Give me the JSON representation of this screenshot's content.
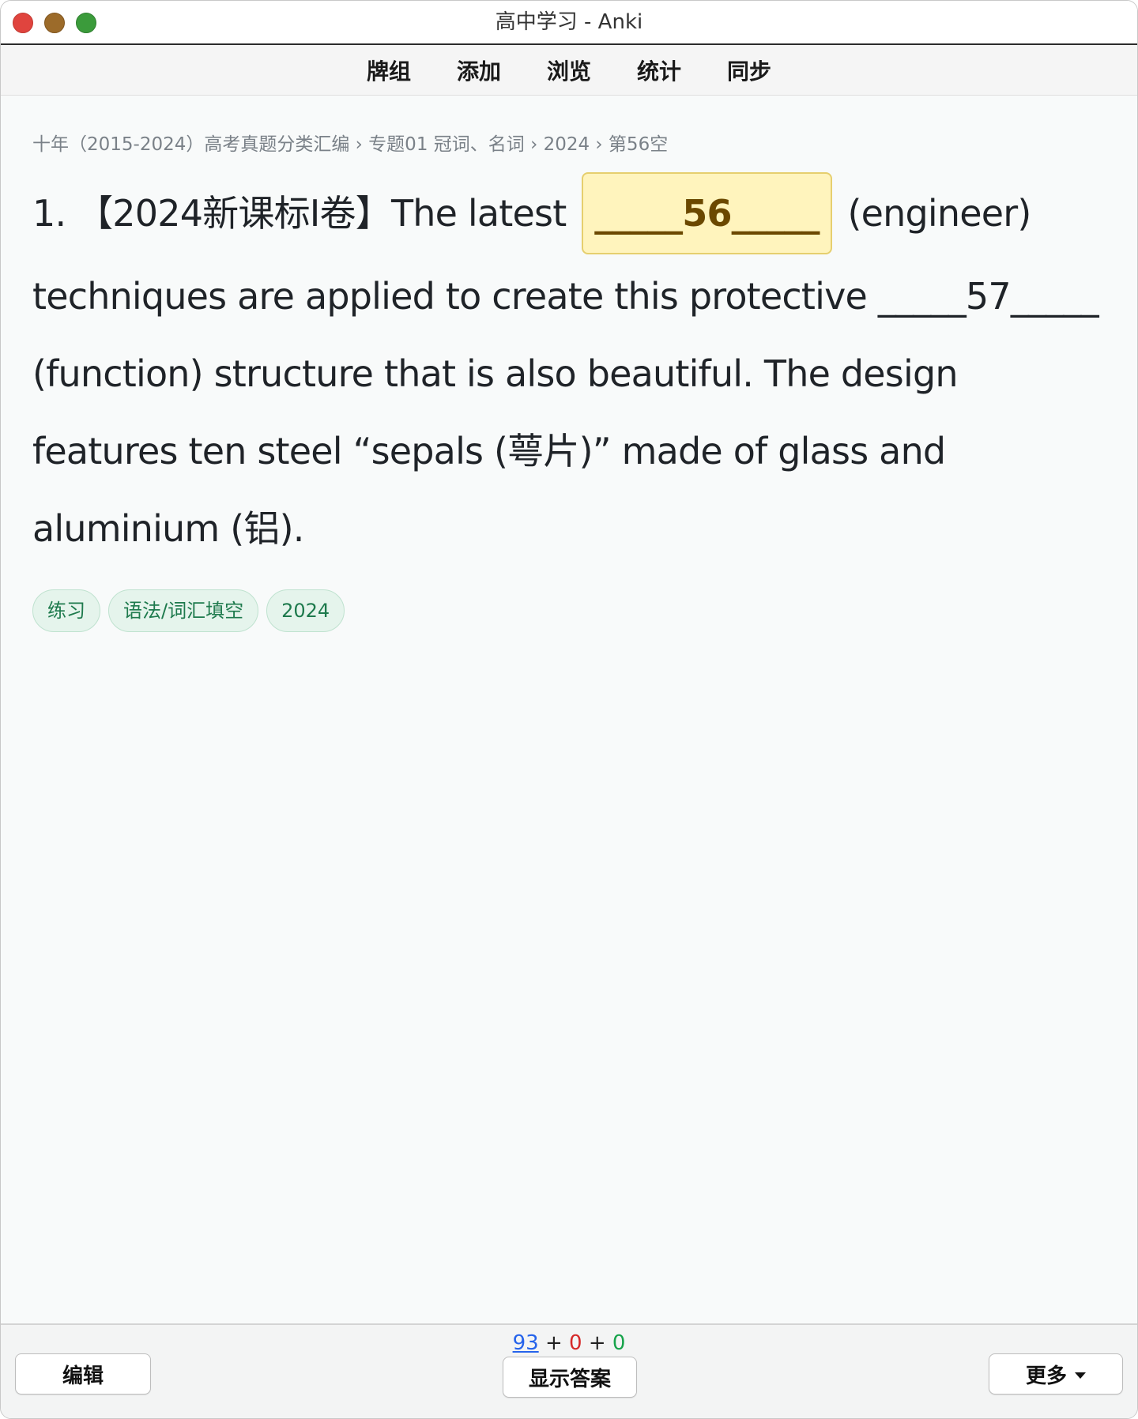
{
  "window": {
    "title": "高中学习 - Anki"
  },
  "topmenu": {
    "items": [
      "牌组",
      "添加",
      "浏览",
      "统计",
      "同步"
    ]
  },
  "card": {
    "breadcrumb": "十年（2015-2024）高考真题分类汇编 › 专题01 冠词、名词 › 2024 › 第56空",
    "question_prefix": "1. 【2024新课标Ⅰ卷】The latest",
    "cloze_active": "_____56_____",
    "text_after_56": "(engineer) techniques are applied to create this protective",
    "cloze_57": "_____57_____",
    "text_after_57": "(function) structure that is also beautiful. The design features ten steel “sepals (萼片)” made of glass and aluminium (铝).",
    "tags": [
      "练习",
      "语法/词汇填空",
      "2024"
    ]
  },
  "bottombar": {
    "count_new": "93",
    "count_learn": "0",
    "count_review": "0",
    "plus": "+",
    "edit_label": "编辑",
    "show_answer_label": "显示答案",
    "more_label": "更多"
  },
  "colors": {
    "cloze_bg": "#fff4bd",
    "tag_bg": "#e5f4ec",
    "count_new": "#2563eb",
    "count_learn": "#d62828",
    "count_review": "#16a34a"
  }
}
